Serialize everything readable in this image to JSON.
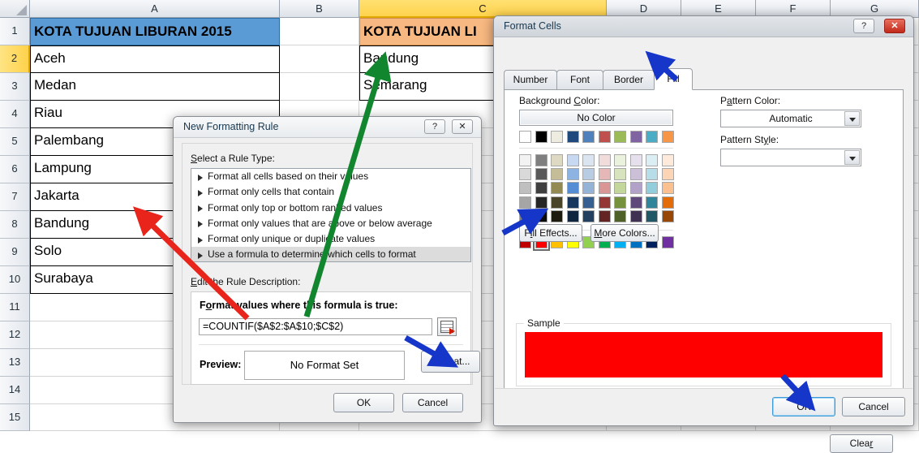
{
  "spreadsheet": {
    "column_headers": [
      "A",
      "B",
      "C",
      "D",
      "E",
      "F",
      "G"
    ],
    "selected_column": "C",
    "selected_row": "2",
    "row_headers": [
      "1",
      "2",
      "3",
      "4",
      "5",
      "6",
      "7",
      "8",
      "9",
      "10",
      "11",
      "12",
      "13",
      "14",
      "15"
    ],
    "column_a": {
      "header": "KOTA TUJUAN LIBURAN 2015",
      "header_color": "#5B9BD5",
      "values": [
        "Aceh",
        "Medan",
        "Riau",
        "Palembang",
        "Lampung",
        "Jakarta",
        "Bandung",
        "Solo",
        "Surabaya"
      ]
    },
    "column_c": {
      "header": "KOTA TUJUAN LI",
      "header_color": "#F8B881",
      "values": [
        "Bandung",
        "Semarang"
      ]
    }
  },
  "new_formatting_rule": {
    "title": "New Formatting Rule",
    "help_button": "?",
    "close_button": "✕",
    "select_rule_type_label": "Select a Rule Type:",
    "rule_types": [
      "Format all cells based on their values",
      "Format only cells that contain",
      "Format only top or bottom ranked values",
      "Format only values that are above or below average",
      "Format only unique or duplicate values",
      "Use a formula to determine which cells to format"
    ],
    "selected_rule_index": 5,
    "edit_rule_description_label": "Edit the Rule Description:",
    "formula_label": "Format values where this formula is true:",
    "formula_value": "=COUNTIF($A$2:$A$10;$C$2)",
    "range_picker_icon": "range-select-icon",
    "preview_label": "Preview:",
    "preview_value": "No Format Set",
    "format_button": "Format...",
    "ok_button": "OK",
    "cancel_button": "Cancel"
  },
  "format_cells": {
    "title": "Format Cells",
    "help_button": "?",
    "close_button": "✕",
    "tabs": [
      "Number",
      "Font",
      "Border",
      "Fill"
    ],
    "active_tab": "Fill",
    "background_color_label": "Background Color:",
    "no_color_button": "No Color",
    "pattern_color_label": "Pattern Color:",
    "pattern_color_value": "Automatic",
    "pattern_style_label": "Pattern Style:",
    "pattern_style_value": "",
    "theme_row_top": [
      "#FFFFFF",
      "#000000",
      "#EEECE1",
      "#1F497D",
      "#4F81BD",
      "#C0504D",
      "#9BBB59",
      "#8064A2",
      "#4BACC6",
      "#F79646"
    ],
    "theme_rows": [
      [
        "#F2F2F2",
        "#7F7F7F",
        "#DDD9C3",
        "#C6D9F0",
        "#DBE5F1",
        "#F2DCDB",
        "#EAF1DD",
        "#E5E0EC",
        "#DAEEF3",
        "#FDEADA"
      ],
      [
        "#D9D9D9",
        "#595959",
        "#C4BD97",
        "#8DB3E2",
        "#B8CCE4",
        "#E5B8B7",
        "#D7E3BC",
        "#CCC0D9",
        "#B7DDE8",
        "#FBD5B5"
      ],
      [
        "#BFBFBF",
        "#3F3F3F",
        "#938953",
        "#548DD4",
        "#95B3D7",
        "#D99694",
        "#C3D69B",
        "#B2A2C7",
        "#92CDDC",
        "#FAC08F"
      ],
      [
        "#A5A5A5",
        "#262626",
        "#494429",
        "#17365D",
        "#366092",
        "#953734",
        "#76923C",
        "#5F497A",
        "#31859B",
        "#E36C09"
      ],
      [
        "#7F7F7F",
        "#0C0C0C",
        "#1D1B10",
        "#0F243E",
        "#244061",
        "#632423",
        "#4F6128",
        "#3F3151",
        "#205867",
        "#974806"
      ]
    ],
    "standard_colors": [
      "#C00000",
      "#FF0000",
      "#FFC000",
      "#FFFF00",
      "#92D050",
      "#00B050",
      "#00B0F0",
      "#0070C0",
      "#002060",
      "#7030A0"
    ],
    "selected_color": "#FF0000",
    "fill_effects_button": "Fill Effects...",
    "more_colors_button": "More Colors...",
    "sample_label": "Sample",
    "sample_color": "#FF0000",
    "clear_button": "Clear",
    "ok_button": "OK",
    "cancel_button": "Cancel"
  },
  "annotations": {
    "red_arrow": "points-to-column-a-cells",
    "green_arrow": "points-to-cell-c2-bandung",
    "blue_arrow_format": "points-to-format-button",
    "blue_arrow_fill_tab": "points-to-fill-tab",
    "blue_arrow_red_swatch": "points-to-red-color-swatch",
    "blue_arrow_ok": "points-to-ok-button",
    "red_color": "#E8241B",
    "green_color": "#11862F",
    "blue_color": "#1536C8"
  }
}
